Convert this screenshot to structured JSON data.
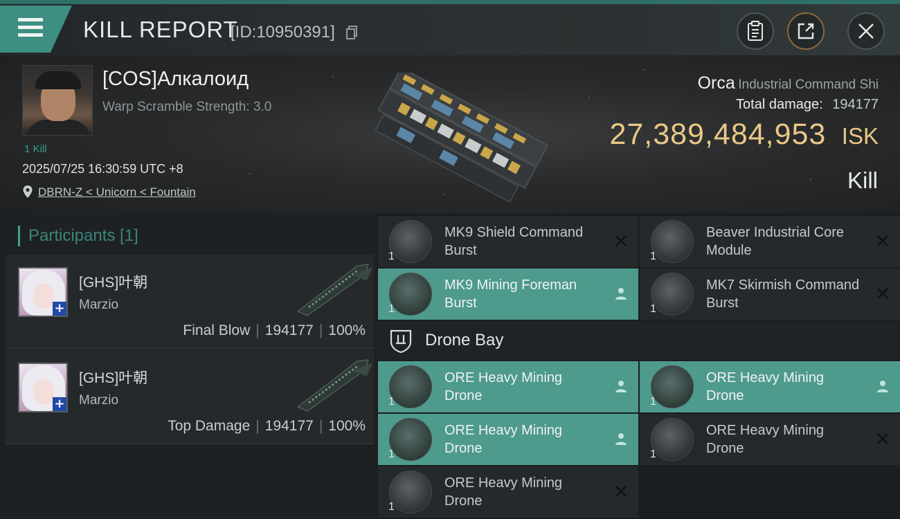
{
  "header": {
    "title": "KILL REPORT",
    "report_id": "[ID:10950391]"
  },
  "victim": {
    "name": "[COS]Алкалоид",
    "warp_scramble": "Warp Scramble Strength: 3.0",
    "kills": "1 Kill",
    "datetime": "2025/07/25 16:30:59 UTC +8",
    "location": "DBRN-Z < Unicorn < Fountain",
    "ship_name": "Orca",
    "ship_class": "Industrial Command Shi",
    "total_damage_label": "Total damage:",
    "total_damage": "194177",
    "isk_value": "27,389,484,953",
    "isk_unit": "ISK",
    "result": "Kill"
  },
  "participants": {
    "label": "Participants [1]",
    "rows": [
      {
        "name": "[GHS]叶朝",
        "corp": "Marzio",
        "role": "Final Blow",
        "damage": "194177",
        "percent": "100%"
      },
      {
        "name": "[GHS]叶朝",
        "corp": "Marzio",
        "role": "Top Damage",
        "damage": "194177",
        "percent": "100%"
      }
    ]
  },
  "modules": [
    {
      "name": "MK9 Shield Command Burst",
      "qty": "1",
      "status": "destroyed",
      "icon": "shield-burst-icon"
    },
    {
      "name": "Beaver Industrial Core Module",
      "qty": "1",
      "status": "destroyed",
      "icon": "industrial-core-icon"
    },
    {
      "name": "MK9 Mining Foreman Burst",
      "qty": "1",
      "status": "dropped",
      "icon": "mining-burst-icon"
    },
    {
      "name": "MK7 Skirmish Command Burst",
      "qty": "1",
      "status": "destroyed",
      "icon": "skirmish-burst-icon"
    }
  ],
  "drone_bay": {
    "label": "Drone Bay",
    "items": [
      {
        "name": "ORE Heavy Mining Drone",
        "qty": "1",
        "status": "dropped",
        "icon": "mining-drone-icon"
      },
      {
        "name": "ORE Heavy Mining Drone",
        "qty": "1",
        "status": "dropped",
        "icon": "mining-drone-icon"
      },
      {
        "name": "ORE Heavy Mining Drone",
        "qty": "1",
        "status": "dropped",
        "icon": "mining-drone-icon"
      },
      {
        "name": "ORE Heavy Mining Drone",
        "qty": "1",
        "status": "destroyed",
        "icon": "mining-drone-icon"
      },
      {
        "name": "ORE Heavy Mining Drone",
        "qty": "1",
        "status": "destroyed",
        "icon": "mining-drone-icon"
      }
    ]
  },
  "colors": {
    "accent": "#3d8f83",
    "dropped_row": "#4e9a8c",
    "isk_gold": "#e9c887"
  }
}
